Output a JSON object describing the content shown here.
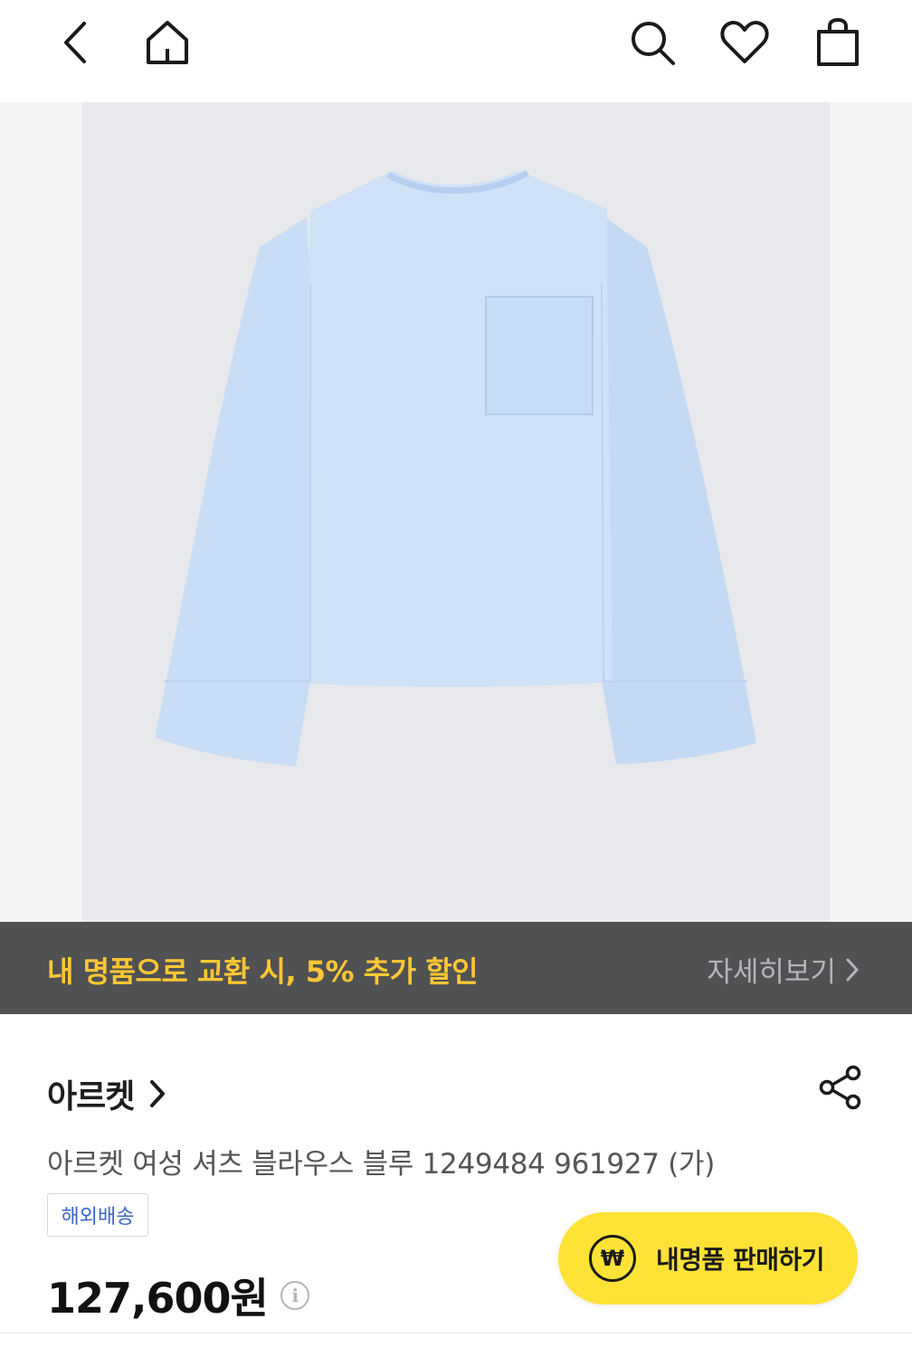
{
  "header": {
    "icons": [
      "back-icon",
      "home-icon",
      "search-icon",
      "heart-icon",
      "shopping-bag-icon"
    ]
  },
  "colors": {
    "promo_bg": "#4f5153",
    "promo_text": "#ffc733",
    "sell_button": "#ffe236",
    "badge_text": "#3c64c8",
    "product_color": "#c6dbf4"
  },
  "promo": {
    "message": "내 명품으로 교환 시, 5% 추가 할인",
    "more_label": "자세히보기"
  },
  "product": {
    "brand": "아르켓",
    "title": "아르켓 여성 셔츠 블라우스 블루 1249484 961927 (가)",
    "badge": "해외배송",
    "price": "127,600원"
  },
  "sell_button": {
    "label": "내명품 판매하기",
    "icon_glyph": "₩"
  }
}
